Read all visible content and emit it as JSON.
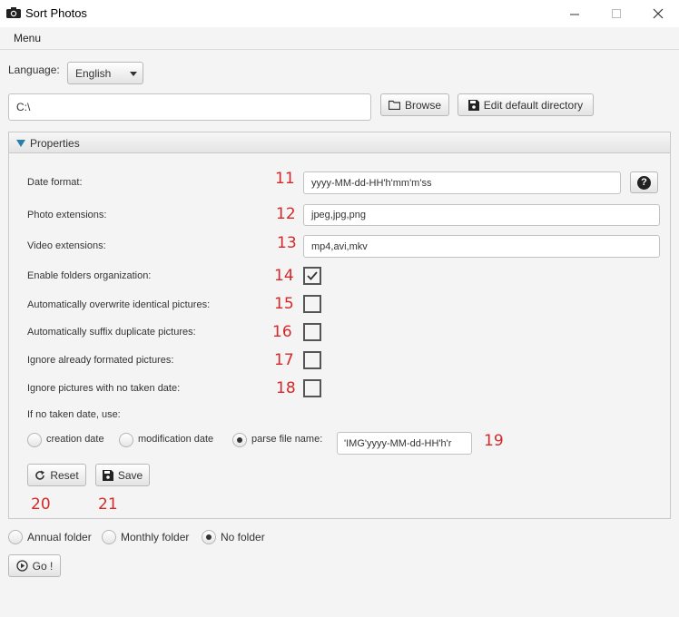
{
  "window": {
    "title": "Sort Photos"
  },
  "menu": {
    "label": "Menu"
  },
  "language": {
    "label": "Language:",
    "selected": "English"
  },
  "directory": {
    "value": "C:\\",
    "browse_label": "Browse",
    "edit_default_label": "Edit default directory"
  },
  "properties": {
    "header": "Properties",
    "date_format": {
      "label": "Date format:",
      "value": "yyyy-MM-dd-HH'h'mm'm'ss",
      "help": "?"
    },
    "photo_ext": {
      "label": "Photo extensions:",
      "value": "jpeg,jpg,png"
    },
    "video_ext": {
      "label": "Video extensions:",
      "value": "mp4,avi,mkv"
    },
    "options": [
      {
        "label": "Enable folders organization:",
        "checked": true,
        "num": "14"
      },
      {
        "label": "Automatically overwrite identical pictures:",
        "checked": false,
        "num": "15"
      },
      {
        "label": "Automatically suffix duplicate pictures:",
        "checked": false,
        "num": "16"
      },
      {
        "label": "Ignore already formated pictures:",
        "checked": false,
        "num": "17"
      },
      {
        "label": "Ignore pictures with no taken date:",
        "checked": false,
        "num": "18"
      }
    ],
    "no_date": {
      "label": "If no taken date, use:",
      "creation": "creation date",
      "modification": "modification date",
      "parse": "parse file name:",
      "selected": "parse",
      "pattern": "'IMG'yyyy-MM-dd-HH'h'r"
    },
    "reset_label": "Reset",
    "save_label": "Save",
    "nums": {
      "date_format": "11",
      "photo_ext": "12",
      "video_ext": "13",
      "pattern": "19",
      "reset": "20",
      "save": "21"
    }
  },
  "folder": {
    "annual": "Annual folder",
    "monthly": "Monthly folder",
    "none": "No folder",
    "selected": "none"
  },
  "go_label": "Go !",
  "colors": {
    "annotation": "#d62828",
    "background": "#f4f4f4"
  }
}
